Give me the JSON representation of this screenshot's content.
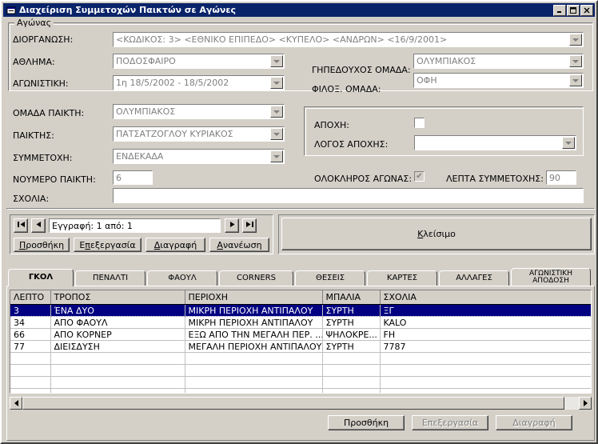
{
  "window": {
    "title": "Διαχείριση Συμμετοχών Παικτών σε Αγώνες",
    "icon": "app-window-icon",
    "minimize": "_",
    "maximize": "☐",
    "close": "✕",
    "titlebar_color": "#0a246a",
    "face_color": "#d4d0c8"
  },
  "match_group": {
    "legend": "Αγώνας",
    "fields": {
      "organization_label": "ΔΙΟΡΓΑΝΩΣΗ:",
      "organization_value": "<ΚΩΔΙΚΟΣ:  3> <ΕΘΝΙΚΟ ΕΠΙΠΕΔΟ> <ΚΥΠΕΛΟ> <ΑΝΔΡΩΝ> <16/9/2001>",
      "sport_label": "ΑΘΛΗΜΑ:",
      "sport_value": "ΠΟΔΟΣΦΑΙΡΟ",
      "matchday_label": "ΑΓΩΝΙΣΤΙΚΗ:",
      "matchday_value": "1η  18/5/2002 - 18/5/2002",
      "home_team_label": "ΓΗΠΕΔΟΥΧΟΣ ΟΜΑΔΑ:",
      "home_team_value": "ΟΛΥΜΠΙΑΚΟΣ",
      "away_team_label": "ΦΙΛΟΞ. ΟΜΑΔΑ:",
      "away_team_value": "ΟΦΗ"
    }
  },
  "player_form": {
    "team_label": "ΟΜΑΔΑ ΠΑΙΚΤΗ:",
    "team_value": "ΟΛΥΜΠΙΑΚΟΣ",
    "player_label": "ΠΑΙΚΤΗΣ:",
    "player_value": "ΠΑΤΣΑΤΖΟΓΛΟΥ ΚΥΡΙΑΚΟΣ",
    "participation_label": "ΣΥΜΜΕΤΟΧΗ:",
    "participation_value": "ΕΝΔΕΚΑΔΑ",
    "number_label": "ΝΟΥΜΕΡΟ ΠΑΙΚΤΗ:",
    "number_value": "6",
    "comments_label": "ΣΧΟΛΙΑ:",
    "comments_value": "",
    "absence_label": "ΑΠΟΧΗ:",
    "absence_checked": false,
    "absence_reason_label": "ΛΟΓΟΣ ΑΠΟΧΗΣ:",
    "absence_reason_value": "",
    "full_match_label": "ΟΛΟΚΛΗΡΟΣ ΑΓΩΝΑΣ:",
    "full_match_checked": true,
    "full_match_mark": "✔",
    "minutes_label": "ΛΕΠΤΑ ΣΥΜΜΕΤΟΧΗΣ:",
    "minutes_value": "90"
  },
  "navigator": {
    "first": "|◀",
    "prev": "◀",
    "record_text": "Εγγραφή: 1 από: 1",
    "next": "▶",
    "last": "▶|",
    "buttons": [
      {
        "label_pre": "",
        "label_underlined": "Π",
        "label_post": "ροσθήκη",
        "name": "add-record-button",
        "disabled": false
      },
      {
        "label_pre": "Ε",
        "label_underlined": "π",
        "label_post": "εξεργασία",
        "name": "edit-record-button",
        "disabled": false
      },
      {
        "label_pre": "",
        "label_underlined": "Δ",
        "label_post": "ιαγραφή",
        "name": "delete-record-button",
        "disabled": false
      },
      {
        "label_pre": "",
        "label_underlined": "Α",
        "label_post": "νανέωση",
        "name": "refresh-record-button",
        "disabled": false
      }
    ],
    "close_pre": "",
    "close_underlined": "Κ",
    "close_post": "λείσιμο"
  },
  "tabs": [
    {
      "label": "ΓΚΟΛ",
      "name": "tab-gkol",
      "active": true
    },
    {
      "label": "ΠΕΝΑΛΤΙ",
      "name": "tab-penalti",
      "active": false
    },
    {
      "label": "ΦΑΟΥΛ",
      "name": "tab-faoul",
      "active": false
    },
    {
      "label": "CORNERS",
      "name": "tab-corners",
      "active": false
    },
    {
      "label": "ΘΕΣΕΙΣ",
      "name": "tab-theseis",
      "active": false
    },
    {
      "label": "ΚΑΡΤΕΣ",
      "name": "tab-kartes",
      "active": false
    },
    {
      "label": "ΑΛΛΑΓΕΣ",
      "name": "tab-allages",
      "active": false
    },
    {
      "label": "ΑΓΩΝΙΣΤΙΚΗ ΑΠΟΔΟΣΗ",
      "name": "tab-agonistiki-apodosi",
      "active": false
    }
  ],
  "grid": {
    "columns": [
      "ΛΕΠΤΟ",
      "ΤΡΟΠΟΣ",
      "ΠΕΡΙΟΧΗ",
      "ΜΠΑΛΙΑ",
      "ΣΧΟΛΙΑ"
    ],
    "rows": [
      {
        "selected": true,
        "cells": [
          "3",
          "ΈΝΑ ΔΥΟ",
          "ΜΙΚΡΗ ΠΕΡΙΟΧΗ ΑΝΤΙΠΑΛΟΥ",
          "ΣΥΡΤΗ",
          "ΞΓ"
        ]
      },
      {
        "selected": false,
        "cells": [
          "34",
          "ΑΠΟ ΦΑΟΥΛ",
          "ΜΙΚΡΗ ΠΕΡΙΟΧΗ ΑΝΤΙΠΑΛΟΥ",
          "ΣΥΡΤΗ",
          "KALO"
        ]
      },
      {
        "selected": false,
        "cells": [
          "66",
          "ΑΠΟ ΚΟΡΝΕΡ",
          "ΕΞΩ ΑΠΟ ΤΗΝ ΜΕΓΑΛΗ ΠΕΡ. ...",
          "ΨΗΛΟΚΡΕ...",
          "FH"
        ]
      },
      {
        "selected": false,
        "cells": [
          "77",
          "ΔΙΕΙΣΔΥΣΗ",
          "ΜΕΓΑΛΗ ΠΕΡΙΟΧΗ ΑΝΤΙΠΑΛΟΥ",
          "ΣΥΡΤΗ",
          "7787"
        ]
      },
      {
        "selected": false,
        "cells": [
          "",
          "",
          "",
          "",
          ""
        ]
      },
      {
        "selected": false,
        "cells": [
          "",
          "",
          "",
          "",
          ""
        ]
      },
      {
        "selected": false,
        "cells": [
          "",
          "",
          "",
          "",
          ""
        ]
      },
      {
        "selected": false,
        "cells": [
          "",
          "",
          "",
          "",
          ""
        ]
      }
    ],
    "scrollbar": {
      "left_arrow": "◀",
      "right_arrow": "▶"
    }
  },
  "footer": {
    "add_label": "Προσθήκη",
    "edit_label": "Επεξεργασία",
    "delete_label": "Διαγραφή",
    "add_disabled": false,
    "edit_disabled": true,
    "delete_disabled": true
  }
}
